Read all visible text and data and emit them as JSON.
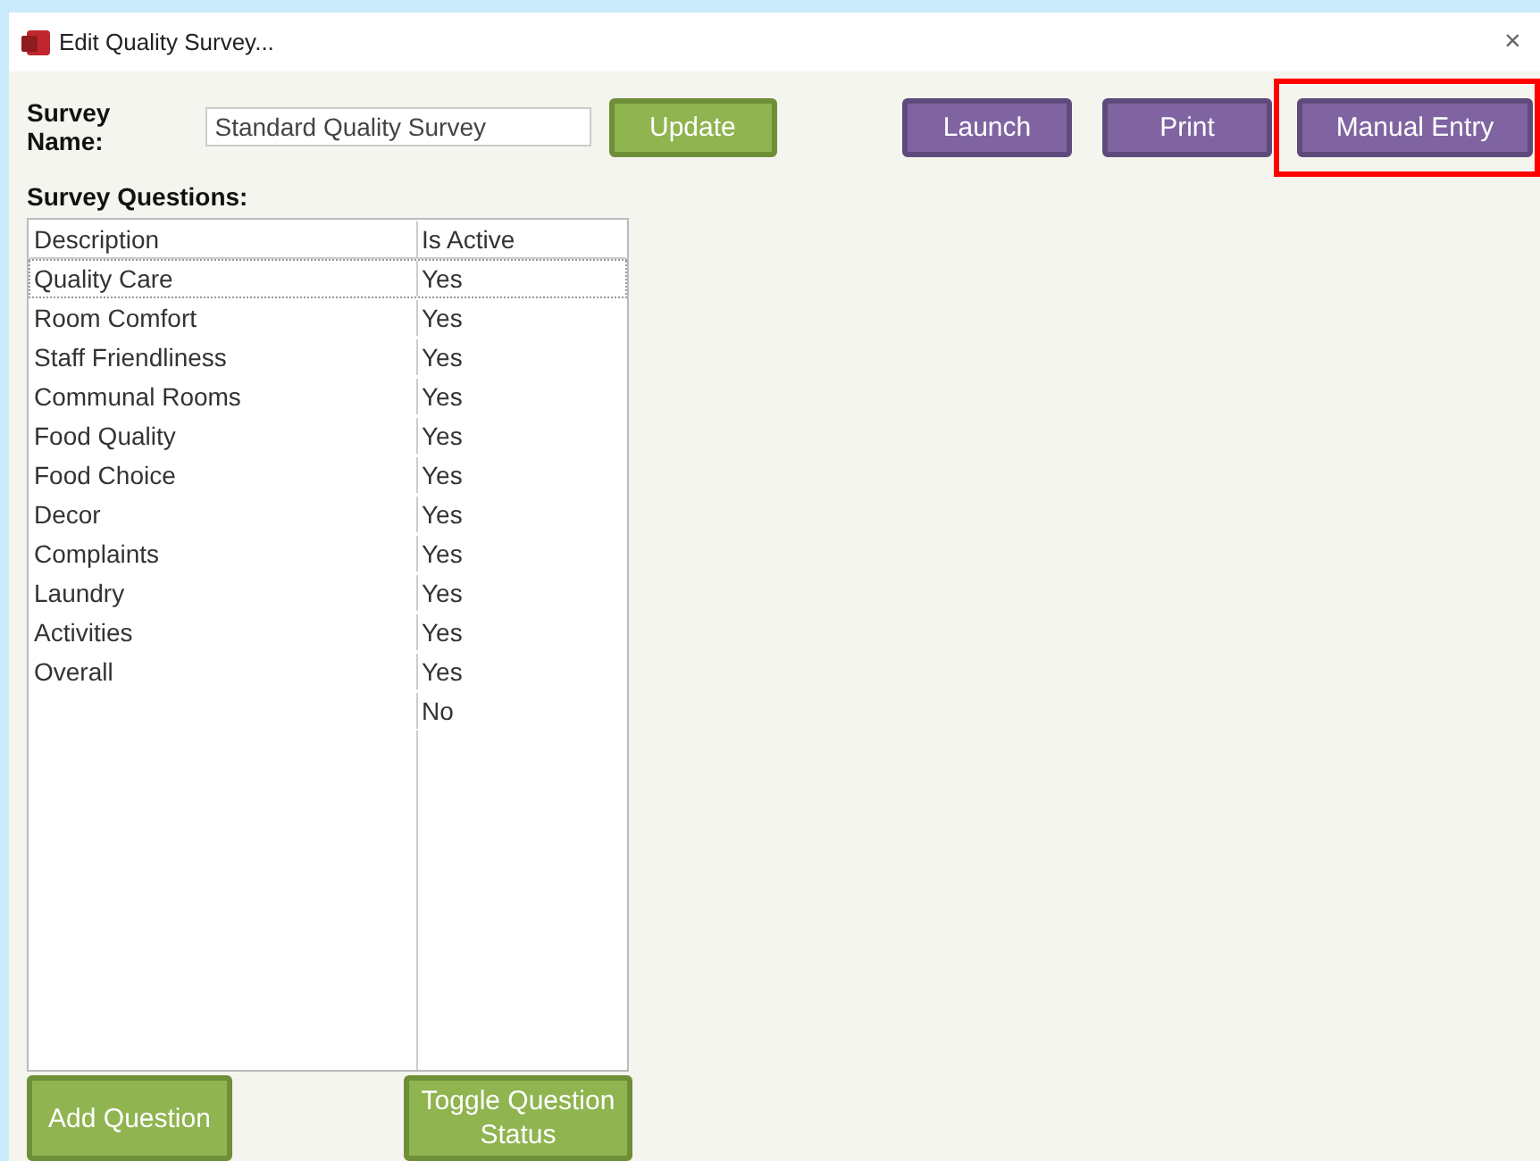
{
  "window": {
    "title": "Edit Quality Survey...",
    "close": "×"
  },
  "survey_name": {
    "label": "Survey Name:",
    "value": "Standard Quality Survey"
  },
  "top_buttons": [
    {
      "label": "Update",
      "kind": "green",
      "highlighted": false
    },
    {
      "label": "Launch",
      "kind": "purple",
      "highlighted": false
    },
    {
      "label": "Print",
      "kind": "purple",
      "highlighted": false
    },
    {
      "label": "Manual Entry",
      "kind": "purple",
      "highlighted": true
    }
  ],
  "questions": {
    "title": "Survey Questions:",
    "columns": [
      "Description",
      "Is Active"
    ],
    "rows": [
      {
        "description": "Quality Care",
        "is_active": "Yes",
        "selected": true
      },
      {
        "description": "Room Comfort",
        "is_active": "Yes",
        "selected": false
      },
      {
        "description": "Staff Friendliness",
        "is_active": "Yes",
        "selected": false
      },
      {
        "description": "Communal Rooms",
        "is_active": "Yes",
        "selected": false
      },
      {
        "description": "Food Quality",
        "is_active": "Yes",
        "selected": false
      },
      {
        "description": "Food Choice",
        "is_active": "Yes",
        "selected": false
      },
      {
        "description": "Decor",
        "is_active": "Yes",
        "selected": false
      },
      {
        "description": "Complaints",
        "is_active": "Yes",
        "selected": false
      },
      {
        "description": "Laundry",
        "is_active": "Yes",
        "selected": false
      },
      {
        "description": "Activities",
        "is_active": "Yes",
        "selected": false
      },
      {
        "description": "Overall",
        "is_active": "Yes",
        "selected": false
      },
      {
        "is_active": "No",
        "selected": false
      }
    ]
  },
  "bottom_buttons": [
    {
      "label": "Add Question"
    },
    {
      "label": "Toggle Question Status"
    }
  ]
}
